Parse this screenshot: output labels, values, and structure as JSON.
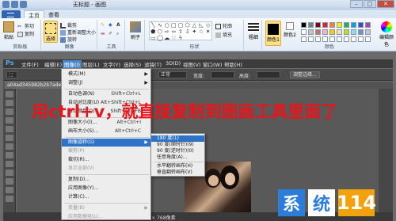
{
  "paint": {
    "title": "无标题 - 画图",
    "tabs": [
      "主页",
      "查看"
    ],
    "groups": {
      "clipboard": {
        "paste": "粘贴",
        "cut": "剪切",
        "copy": "复制",
        "label": "剪贴板"
      },
      "image": {
        "select": "选择",
        "crop": "裁剪",
        "resize": "重新调整大小",
        "rotate": "旋转",
        "label": "图像"
      },
      "tools": {
        "label": "工具"
      },
      "brushes": {
        "label": "刷子"
      },
      "shapes": {
        "outline": "轮廓",
        "fill": "填充",
        "label": "形状"
      },
      "size": {
        "label": "粗细"
      },
      "colors": {
        "color1": "颜色1",
        "color2": "颜色2",
        "edit": "编辑颜色",
        "label": "颜色"
      }
    }
  },
  "photoshop": {
    "logo": "Ps",
    "menus": [
      "文件(F)",
      "编辑(E)",
      "图像(I)",
      "图层(L)",
      "文字(Y)",
      "选择(S)",
      "滤镜(T)",
      "3D(D)",
      "视图(V)",
      "窗口(W)",
      "帮助(H)"
    ],
    "options": {
      "mode": "正常",
      "width_label": "宽度:",
      "height_label": "高度:",
      "refine_button": "调整边缘..."
    },
    "doc_tab": "a04ad345982b2b7aden",
    "status": "1360 × 768像素"
  },
  "image_menu": {
    "items": [
      {
        "label": "模式(M)",
        "shortcut": "",
        "arrow": true,
        "disabled": false
      },
      {
        "label": "调整(J)",
        "shortcut": "",
        "arrow": true,
        "disabled": false
      },
      {
        "label": "自动色调(N)",
        "shortcut": "Shift+Ctrl+L",
        "arrow": false,
        "disabled": false
      },
      {
        "label": "自动对比度(U)",
        "shortcut": "Alt+Shift+Ctrl+L",
        "arrow": false,
        "disabled": false
      },
      {
        "label": "自动颜色(O)",
        "shortcut": "Shift+Ctrl+B",
        "arrow": false,
        "disabled": false
      },
      {
        "label": "图像大小(I)...",
        "shortcut": "Alt+Ctrl+I",
        "arrow": false,
        "disabled": false
      },
      {
        "label": "画布大小(S)...",
        "shortcut": "Alt+Ctrl+C",
        "arrow": false,
        "disabled": false
      },
      {
        "label": "图像旋转(G)",
        "shortcut": "",
        "arrow": true,
        "disabled": false,
        "highlighted": true
      },
      {
        "label": "裁剪(P)",
        "shortcut": "",
        "arrow": false,
        "disabled": true
      },
      {
        "label": "裁切(R)...",
        "shortcut": "",
        "arrow": false,
        "disabled": false
      },
      {
        "label": "显示全部(V)",
        "shortcut": "",
        "arrow": false,
        "disabled": true
      },
      {
        "label": "复制(D)...",
        "shortcut": "",
        "arrow": false,
        "disabled": false
      },
      {
        "label": "应用图像(Y)...",
        "shortcut": "",
        "arrow": false,
        "disabled": false
      },
      {
        "label": "计算(C)...",
        "shortcut": "",
        "arrow": false,
        "disabled": false
      },
      {
        "label": "变量(B)",
        "shortcut": "",
        "arrow": true,
        "disabled": true
      },
      {
        "label": "应用数据组(L)...",
        "shortcut": "",
        "arrow": false,
        "disabled": true
      }
    ]
  },
  "rotate_menu": {
    "items": [
      "180 度(1)",
      "90 度(顺时针)(9)",
      "90 度(逆时针)(0)",
      "任意角度(A)...",
      "水平翻转画布(H)",
      "垂直翻转画布(V)"
    ]
  },
  "overlay_text": "用ctrl+v，就直接复制到图画工具里面了",
  "logo": {
    "c1": "系",
    "c2": "统",
    "c3": "114"
  }
}
